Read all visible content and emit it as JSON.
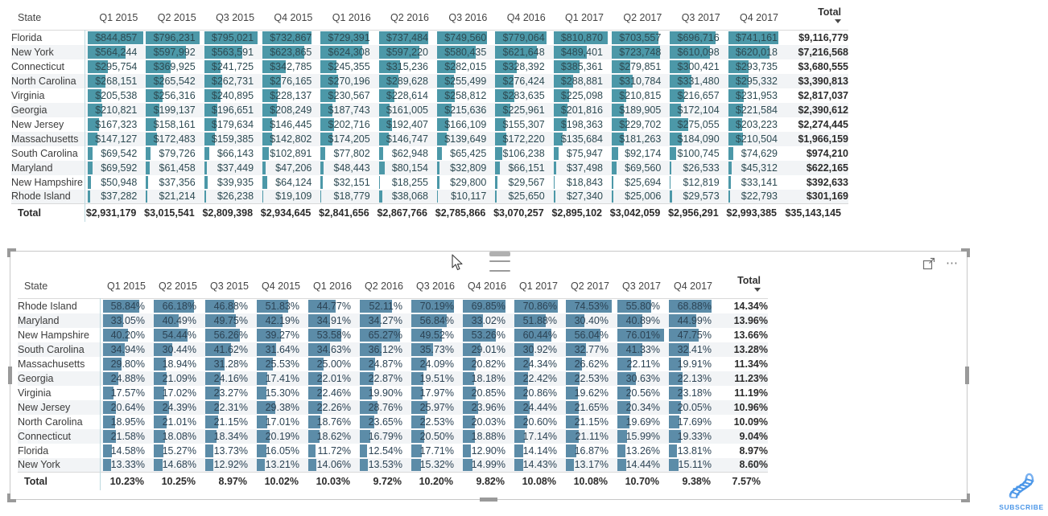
{
  "app": "power-bi-report-view",
  "colors": {
    "bar_currency": "#4c98a8",
    "bar_percent": "#5c8ca8",
    "row_alt": "#f2f4f6",
    "header_rule": "#a9d3dc",
    "subscribe": "#4c97e8"
  },
  "visual_toolbar": {
    "focus_mode_icon": "focus-mode-icon",
    "more_options_icon": "more-options-ellipsis-icon",
    "drag_handle_icon": "drag-handle-icon",
    "cursor_icon": "mouse-pointer-icon"
  },
  "branding": {
    "logo_icon": "dna-helix-icon",
    "label": "SUBSCRIBE"
  },
  "top_table": {
    "columns": [
      "State",
      "Q1 2015",
      "Q2 2015",
      "Q3 2015",
      "Q4 2015",
      "Q1 2016",
      "Q2 2016",
      "Q3 2016",
      "Q4 2016",
      "Q1 2017",
      "Q2 2017",
      "Q3 2017",
      "Q4 2017",
      "Total"
    ],
    "sorted_column": "Total",
    "sort_direction": "desc",
    "value_format": "currency",
    "rows": [
      {
        "state": "Florida",
        "values": [
          "$844,857",
          "$796,231",
          "$795,021",
          "$732,867",
          "$729,391",
          "$737,484",
          "$749,560",
          "$779,064",
          "$810,870",
          "$703,557",
          "$696,716",
          "$741,161"
        ],
        "total": "$9,116,779"
      },
      {
        "state": "New York",
        "values": [
          "$564,244",
          "$597,992",
          "$563,591",
          "$623,865",
          "$624,308",
          "$597,220",
          "$580,435",
          "$621,648",
          "$489,401",
          "$723,748",
          "$610,098",
          "$620,018"
        ],
        "total": "$7,216,568"
      },
      {
        "state": "Connecticut",
        "values": [
          "$295,754",
          "$369,925",
          "$241,725",
          "$342,785",
          "$245,355",
          "$315,236",
          "$282,015",
          "$328,392",
          "$385,361",
          "$279,851",
          "$300,421",
          "$293,735"
        ],
        "total": "$3,680,555"
      },
      {
        "state": "North Carolina",
        "values": [
          "$268,151",
          "$265,542",
          "$262,731",
          "$276,165",
          "$270,196",
          "$289,628",
          "$255,499",
          "$276,424",
          "$288,881",
          "$310,784",
          "$331,480",
          "$295,332"
        ],
        "total": "$3,390,813"
      },
      {
        "state": "Virginia",
        "values": [
          "$205,538",
          "$256,316",
          "$240,895",
          "$228,137",
          "$230,567",
          "$228,614",
          "$258,812",
          "$283,635",
          "$225,098",
          "$210,815",
          "$216,657",
          "$231,953"
        ],
        "total": "$2,817,037"
      },
      {
        "state": "Georgia",
        "values": [
          "$210,821",
          "$199,137",
          "$196,651",
          "$208,249",
          "$187,743",
          "$161,005",
          "$215,636",
          "$225,961",
          "$201,816",
          "$189,905",
          "$172,104",
          "$221,584"
        ],
        "total": "$2,390,612"
      },
      {
        "state": "New Jersey",
        "values": [
          "$167,323",
          "$158,161",
          "$179,634",
          "$146,445",
          "$202,716",
          "$192,407",
          "$166,109",
          "$155,307",
          "$198,363",
          "$229,702",
          "$275,055",
          "$203,223"
        ],
        "total": "$2,274,445"
      },
      {
        "state": "Massachusetts",
        "values": [
          "$147,127",
          "$172,483",
          "$159,385",
          "$142,802",
          "$174,205",
          "$146,747",
          "$139,649",
          "$172,220",
          "$135,684",
          "$181,263",
          "$184,090",
          "$210,504"
        ],
        "total": "$1,966,159"
      },
      {
        "state": "South Carolina",
        "values": [
          "$69,542",
          "$79,726",
          "$66,143",
          "$102,891",
          "$77,802",
          "$62,948",
          "$65,425",
          "$106,238",
          "$75,947",
          "$92,174",
          "$100,745",
          "$74,629"
        ],
        "total": "$974,210"
      },
      {
        "state": "Maryland",
        "values": [
          "$69,592",
          "$61,458",
          "$37,449",
          "$47,206",
          "$48,443",
          "$80,154",
          "$32,809",
          "$66,151",
          "$37,498",
          "$69,560",
          "$26,533",
          "$45,312"
        ],
        "total": "$622,165"
      },
      {
        "state": "New Hampshire",
        "values": [
          "$50,948",
          "$37,356",
          "$39,935",
          "$64,124",
          "$32,151",
          "$18,255",
          "$29,800",
          "$29,567",
          "$18,843",
          "$25,694",
          "$12,819",
          "$33,141"
        ],
        "total": "$392,633"
      },
      {
        "state": "Rhode Island",
        "values": [
          "$37,282",
          "$21,214",
          "$26,238",
          "$19,109",
          "$18,779",
          "$38,068",
          "$10,117",
          "$25,650",
          "$27,340",
          "$25,006",
          "$29,573",
          "$22,793"
        ],
        "total": "$301,169"
      }
    ],
    "total_row": {
      "label": "Total",
      "values": [
        "$2,931,179",
        "$3,015,541",
        "$2,809,398",
        "$2,934,645",
        "$2,841,656",
        "$2,867,766",
        "$2,785,866",
        "$3,070,257",
        "$2,895,102",
        "$3,042,059",
        "$2,956,291",
        "$2,993,385"
      ],
      "total": "$35,143,145"
    },
    "bar_fractions": [
      [
        1.0,
        0.95,
        0.94,
        0.87,
        0.86,
        0.87,
        0.89,
        0.92,
        0.96,
        0.83,
        0.82,
        0.88
      ],
      [
        0.67,
        0.71,
        0.67,
        0.74,
        0.74,
        0.71,
        0.69,
        0.74,
        0.58,
        0.86,
        0.72,
        0.73
      ],
      [
        0.35,
        0.44,
        0.29,
        0.41,
        0.29,
        0.37,
        0.33,
        0.39,
        0.46,
        0.33,
        0.36,
        0.35
      ],
      [
        0.32,
        0.31,
        0.31,
        0.33,
        0.32,
        0.34,
        0.3,
        0.33,
        0.34,
        0.37,
        0.39,
        0.35
      ],
      [
        0.24,
        0.3,
        0.29,
        0.27,
        0.27,
        0.27,
        0.31,
        0.34,
        0.27,
        0.25,
        0.26,
        0.27
      ],
      [
        0.25,
        0.24,
        0.23,
        0.25,
        0.22,
        0.19,
        0.26,
        0.27,
        0.24,
        0.22,
        0.2,
        0.26
      ],
      [
        0.2,
        0.19,
        0.21,
        0.17,
        0.24,
        0.23,
        0.2,
        0.18,
        0.23,
        0.27,
        0.33,
        0.24
      ],
      [
        0.17,
        0.2,
        0.19,
        0.17,
        0.21,
        0.17,
        0.17,
        0.2,
        0.16,
        0.21,
        0.22,
        0.25
      ],
      [
        0.08,
        0.09,
        0.08,
        0.12,
        0.09,
        0.07,
        0.08,
        0.13,
        0.09,
        0.11,
        0.12,
        0.09
      ],
      [
        0.08,
        0.07,
        0.04,
        0.06,
        0.06,
        0.1,
        0.04,
        0.08,
        0.04,
        0.08,
        0.03,
        0.05
      ],
      [
        0.06,
        0.04,
        0.05,
        0.08,
        0.04,
        0.02,
        0.04,
        0.04,
        0.02,
        0.03,
        0.01,
        0.04
      ],
      [
        0.04,
        0.03,
        0.03,
        0.02,
        0.02,
        0.05,
        0.01,
        0.03,
        0.03,
        0.03,
        0.04,
        0.03
      ]
    ]
  },
  "bottom_table": {
    "columns": [
      "State",
      "Q1 2015",
      "Q2 2015",
      "Q3 2015",
      "Q4 2015",
      "Q1 2016",
      "Q2 2016",
      "Q3 2016",
      "Q4 2016",
      "Q1 2017",
      "Q2 2017",
      "Q3 2017",
      "Q4 2017",
      "Total"
    ],
    "sorted_column": "Total",
    "sort_direction": "desc",
    "value_format": "percent",
    "rows": [
      {
        "state": "Rhode Island",
        "values": [
          "58.84%",
          "66.18%",
          "46.88%",
          "51.83%",
          "44.77%",
          "52.11%",
          "70.19%",
          "69.85%",
          "70.86%",
          "74.53%",
          "55.80%",
          "68.88%"
        ],
        "total": "14.34%"
      },
      {
        "state": "Maryland",
        "values": [
          "33.05%",
          "40.49%",
          "49.75%",
          "42.19%",
          "34.91%",
          "34.27%",
          "56.84%",
          "33.02%",
          "51.88%",
          "30.40%",
          "40.89%",
          "44.99%"
        ],
        "total": "13.96%"
      },
      {
        "state": "New Hampshire",
        "values": [
          "40.20%",
          "54.44%",
          "56.26%",
          "39.27%",
          "53.58%",
          "65.27%",
          "49.52%",
          "53.26%",
          "60.44%",
          "56.04%",
          "76.01%",
          "47.75%"
        ],
        "total": "13.66%"
      },
      {
        "state": "South Carolina",
        "values": [
          "34.94%",
          "30.44%",
          "41.62%",
          "31.64%",
          "34.63%",
          "36.12%",
          "35.73%",
          "29.01%",
          "30.92%",
          "32.77%",
          "41.33%",
          "32.41%"
        ],
        "total": "13.28%"
      },
      {
        "state": "Massachusetts",
        "values": [
          "29.80%",
          "18.94%",
          "31.28%",
          "25.53%",
          "25.00%",
          "24.87%",
          "24.09%",
          "20.82%",
          "24.34%",
          "26.62%",
          "22.11%",
          "19.91%"
        ],
        "total": "11.34%"
      },
      {
        "state": "Georgia",
        "values": [
          "24.88%",
          "21.09%",
          "24.16%",
          "17.41%",
          "22.01%",
          "22.87%",
          "19.51%",
          "18.18%",
          "22.42%",
          "22.53%",
          "30.63%",
          "22.13%"
        ],
        "total": "11.23%"
      },
      {
        "state": "Virginia",
        "values": [
          "17.57%",
          "17.02%",
          "23.27%",
          "15.30%",
          "22.46%",
          "19.90%",
          "17.97%",
          "20.85%",
          "20.86%",
          "19.62%",
          "20.56%",
          "23.18%"
        ],
        "total": "11.19%"
      },
      {
        "state": "New Jersey",
        "values": [
          "20.64%",
          "24.39%",
          "22.31%",
          "29.38%",
          "22.26%",
          "28.76%",
          "25.97%",
          "23.96%",
          "24.44%",
          "21.65%",
          "20.34%",
          "20.05%"
        ],
        "total": "10.96%"
      },
      {
        "state": "North Carolina",
        "values": [
          "18.95%",
          "21.01%",
          "21.15%",
          "17.01%",
          "18.76%",
          "23.65%",
          "22.53%",
          "20.03%",
          "20.60%",
          "21.15%",
          "19.69%",
          "17.69%"
        ],
        "total": "10.09%"
      },
      {
        "state": "Connecticut",
        "values": [
          "21.58%",
          "18.08%",
          "18.34%",
          "20.19%",
          "18.62%",
          "16.79%",
          "20.50%",
          "18.88%",
          "17.14%",
          "21.11%",
          "15.99%",
          "19.33%"
        ],
        "total": "9.04%"
      },
      {
        "state": "Florida",
        "values": [
          "14.58%",
          "15.27%",
          "13.73%",
          "16.05%",
          "11.72%",
          "12.54%",
          "17.71%",
          "12.90%",
          "14.14%",
          "16.87%",
          "13.26%",
          "13.81%"
        ],
        "total": "8.97%"
      },
      {
        "state": "New York",
        "values": [
          "13.33%",
          "14.68%",
          "12.92%",
          "13.21%",
          "14.06%",
          "13.53%",
          "15.32%",
          "14.99%",
          "14.43%",
          "13.17%",
          "14.44%",
          "15.11%"
        ],
        "total": "8.60%"
      }
    ],
    "total_row": {
      "label": "Total",
      "values": [
        "10.23%",
        "10.25%",
        "8.97%",
        "10.02%",
        "10.03%",
        "9.72%",
        "10.20%",
        "9.82%",
        "10.08%",
        "10.08%",
        "10.70%",
        "9.38%"
      ],
      "total": "7.57%"
    },
    "bar_fractions": [
      [
        0.77,
        0.87,
        0.62,
        0.68,
        0.59,
        0.69,
        0.92,
        0.92,
        0.93,
        0.98,
        0.73,
        0.91
      ],
      [
        0.43,
        0.53,
        0.65,
        0.55,
        0.46,
        0.45,
        0.75,
        0.43,
        0.68,
        0.4,
        0.54,
        0.59
      ],
      [
        0.53,
        0.72,
        0.74,
        0.52,
        0.7,
        0.86,
        0.65,
        0.7,
        0.79,
        0.74,
        1.0,
        0.63
      ],
      [
        0.46,
        0.4,
        0.55,
        0.42,
        0.46,
        0.47,
        0.47,
        0.38,
        0.41,
        0.43,
        0.54,
        0.43
      ],
      [
        0.39,
        0.25,
        0.41,
        0.34,
        0.33,
        0.33,
        0.32,
        0.27,
        0.32,
        0.35,
        0.29,
        0.26
      ],
      [
        0.33,
        0.28,
        0.32,
        0.23,
        0.29,
        0.3,
        0.26,
        0.24,
        0.29,
        0.3,
        0.4,
        0.29
      ],
      [
        0.23,
        0.22,
        0.31,
        0.2,
        0.3,
        0.26,
        0.24,
        0.27,
        0.27,
        0.26,
        0.27,
        0.3
      ],
      [
        0.27,
        0.32,
        0.29,
        0.39,
        0.29,
        0.38,
        0.34,
        0.32,
        0.32,
        0.28,
        0.27,
        0.26
      ],
      [
        0.25,
        0.28,
        0.28,
        0.22,
        0.25,
        0.31,
        0.3,
        0.26,
        0.27,
        0.28,
        0.26,
        0.23
      ],
      [
        0.28,
        0.24,
        0.24,
        0.27,
        0.24,
        0.22,
        0.27,
        0.25,
        0.23,
        0.28,
        0.21,
        0.25
      ],
      [
        0.19,
        0.2,
        0.18,
        0.21,
        0.15,
        0.16,
        0.23,
        0.17,
        0.19,
        0.22,
        0.17,
        0.18
      ],
      [
        0.18,
        0.19,
        0.17,
        0.17,
        0.18,
        0.18,
        0.2,
        0.2,
        0.19,
        0.17,
        0.19,
        0.2
      ]
    ]
  }
}
